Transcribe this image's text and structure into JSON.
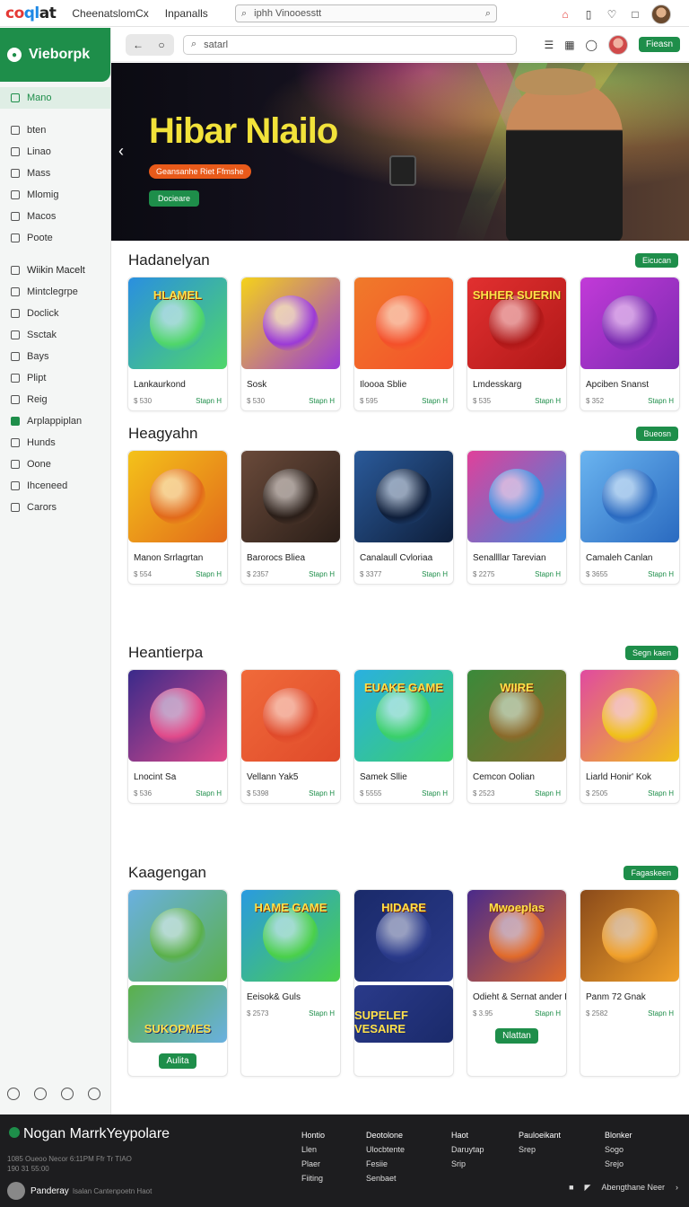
{
  "topbar": {
    "logo_parts": [
      "co",
      "ql",
      "at"
    ],
    "tabs": [
      "CheenatslomCx",
      "Inpanalls"
    ],
    "search_value": "iphh Vinooesstt",
    "icons": [
      "home-icon",
      "document-icon",
      "heart-icon",
      "window-icon",
      "avatar"
    ]
  },
  "sidebar": {
    "brand": "Vieborpk",
    "items": [
      {
        "label": "Mano",
        "active": true
      },
      {
        "label": "bten"
      },
      {
        "label": "Linao"
      },
      {
        "label": "Mass"
      },
      {
        "label": "Mlomig"
      },
      {
        "label": "Macos"
      },
      {
        "label": "Poote"
      },
      {
        "label": "Wiikin Macelt",
        "bold": true
      },
      {
        "label": "Mintclegrpe"
      },
      {
        "label": "Doclick"
      },
      {
        "label": "Ssctak"
      },
      {
        "label": "Bays"
      },
      {
        "label": "Plipt"
      },
      {
        "label": "Reig"
      },
      {
        "label": "Arplappiplan",
        "green": true
      },
      {
        "label": "Hunds"
      },
      {
        "label": "Oone"
      },
      {
        "label": "Ihceneed"
      },
      {
        "label": "Carors"
      }
    ]
  },
  "toolbar": {
    "search_value": "satarl",
    "primary_button": "Fieasn"
  },
  "hero": {
    "title": "Hibar Nlailo",
    "badge": "Geansanhe Riet Ffmshe",
    "button": "Docieare"
  },
  "sections": [
    {
      "title": "Hadanelyan",
      "button": "Eicucan",
      "cards": [
        {
          "name": "Lankaurkond",
          "price": "$ 530",
          "action": "Stapn H",
          "art_text": "HLAMEL",
          "colors": [
            "#2a8fe0",
            "#4fd66a"
          ]
        },
        {
          "name": "Sosk",
          "price": "$ 530",
          "action": "Stapn H",
          "art_text": "",
          "colors": [
            "#f4d21a",
            "#9b3ad6"
          ]
        },
        {
          "name": "Iloooa Sblie",
          "price": "$ 595",
          "action": "Stapn H",
          "art_text": "",
          "colors": [
            "#f07a2a",
            "#f4502a"
          ]
        },
        {
          "name": "Lmdesskarg",
          "price": "$ 535",
          "action": "Stapn H",
          "art_text": "SHHER SUERIN",
          "colors": [
            "#e23030",
            "#b01818"
          ]
        },
        {
          "name": "Apciben Snanst",
          "price": "$ 352",
          "action": "Stapn H",
          "art_text": "",
          "colors": [
            "#c23ad8",
            "#7a2ab0"
          ]
        }
      ]
    },
    {
      "title": "Heagyahn",
      "button": "Bueosn",
      "cards": [
        {
          "name": "Manon Srrlagrtan",
          "price": "$ 554",
          "action": "Stapn H",
          "art_text": "",
          "colors": [
            "#f4c21a",
            "#e26a1a"
          ]
        },
        {
          "name": "Barorocs Bliea",
          "price": "$ 2357",
          "action": "Stapn H",
          "art_text": "",
          "colors": [
            "#6a4a3a",
            "#2a1e18"
          ]
        },
        {
          "name": "Canalaull Cvloriaa",
          "price": "$ 3377",
          "action": "Stapn H",
          "art_text": "",
          "colors": [
            "#2a5a9a",
            "#0e1e3a"
          ]
        },
        {
          "name": "Senallllar Tarevian",
          "price": "$ 2275",
          "action": "Stapn H",
          "art_text": "",
          "colors": [
            "#e0409a",
            "#3a8ae0"
          ]
        },
        {
          "name": "Camaleh Canlan",
          "price": "$ 3655",
          "action": "Stapn H",
          "art_text": "",
          "colors": [
            "#6ab4f0",
            "#2a6ac0"
          ]
        }
      ]
    },
    {
      "title": "Heantierpa",
      "button": "Segn kaen",
      "cards": [
        {
          "name": "Lnocint Sa",
          "price": "$ 536",
          "action": "Stapn H",
          "art_text": "",
          "colors": [
            "#3a2a8a",
            "#e04a8a"
          ]
        },
        {
          "name": "Vellann Yak5",
          "price": "$ 5398",
          "action": "Stapn H",
          "art_text": "",
          "colors": [
            "#f06a3a",
            "#e04a2a"
          ]
        },
        {
          "name": "Samek Sllie",
          "price": "$ 5555",
          "action": "Stapn H",
          "art_text": "EUAKE GAME",
          "colors": [
            "#2ab0e0",
            "#3ad06a"
          ]
        },
        {
          "name": "Cemcon Oolian",
          "price": "$ 2523",
          "action": "Stapn H",
          "art_text": "WIIRE",
          "colors": [
            "#3a8a3a",
            "#8a6a2a"
          ]
        },
        {
          "name": "Liarld Honir' Kok",
          "price": "$ 2505",
          "action": "Stapn H",
          "art_text": "",
          "colors": [
            "#e04aa0",
            "#f0c01a"
          ]
        }
      ]
    },
    {
      "title": "Kaagengan",
      "button": "Fagaskeen",
      "cards": [
        {
          "name": "",
          "price": "",
          "action": "",
          "art_text": "",
          "colors": [
            "#6ab0e0",
            "#5ab04a"
          ],
          "bottom_label": "SUKOPMES",
          "button": "Aulita"
        },
        {
          "name": "Eeisok& Guls",
          "price": "$ 2573",
          "action": "Stapn H",
          "art_text": "HAME GAME",
          "colors": [
            "#2a9ae0",
            "#4ad04a"
          ]
        },
        {
          "name": "",
          "price": "",
          "action": "",
          "art_text": "HIDARE",
          "colors": [
            "#1a2a6a",
            "#2a3a8a"
          ],
          "bottom_label": "SUPELEF VESAIRE",
          "button": ""
        },
        {
          "name": "Odieht & Sernat ander Hagexes",
          "price": "$ 3.95",
          "action": "Stapn H",
          "art_text": "Mwoeplas",
          "colors": [
            "#4a2a8a",
            "#e06a2a"
          ],
          "button": "Nlattan"
        },
        {
          "name": "Panm 72 Gnak",
          "price": "$ 2582",
          "action": "Stapn H",
          "art_text": "",
          "colors": [
            "#8a4a1a",
            "#f0a02a"
          ]
        }
      ]
    }
  ],
  "footer": {
    "title": "Nogan MarrkYeypolare",
    "small_lines": [
      "1085 Oueoo Necor 6:11PM Ffr Tr TIAO",
      "190 31 55:00"
    ],
    "columns": [
      {
        "head": "Hontio",
        "items": [
          "Llen",
          "Plaer",
          "Fiiting"
        ]
      },
      {
        "head": "Deotolone",
        "items": [
          "Ulocbtente",
          "Fesiie",
          "Senbaet"
        ]
      },
      {
        "head": "Haot",
        "items": [
          "Daruytap",
          "Srip"
        ]
      },
      {
        "head": "Pauloeikant",
        "items": [
          "Srep"
        ]
      },
      {
        "head": "Blonker",
        "items": [
          "Sogo",
          "Srejo"
        ]
      }
    ],
    "user": "Panderay",
    "user_sub": "Isalan Cantenpoetn Haot",
    "right_text": "Abengthane Neer"
  }
}
